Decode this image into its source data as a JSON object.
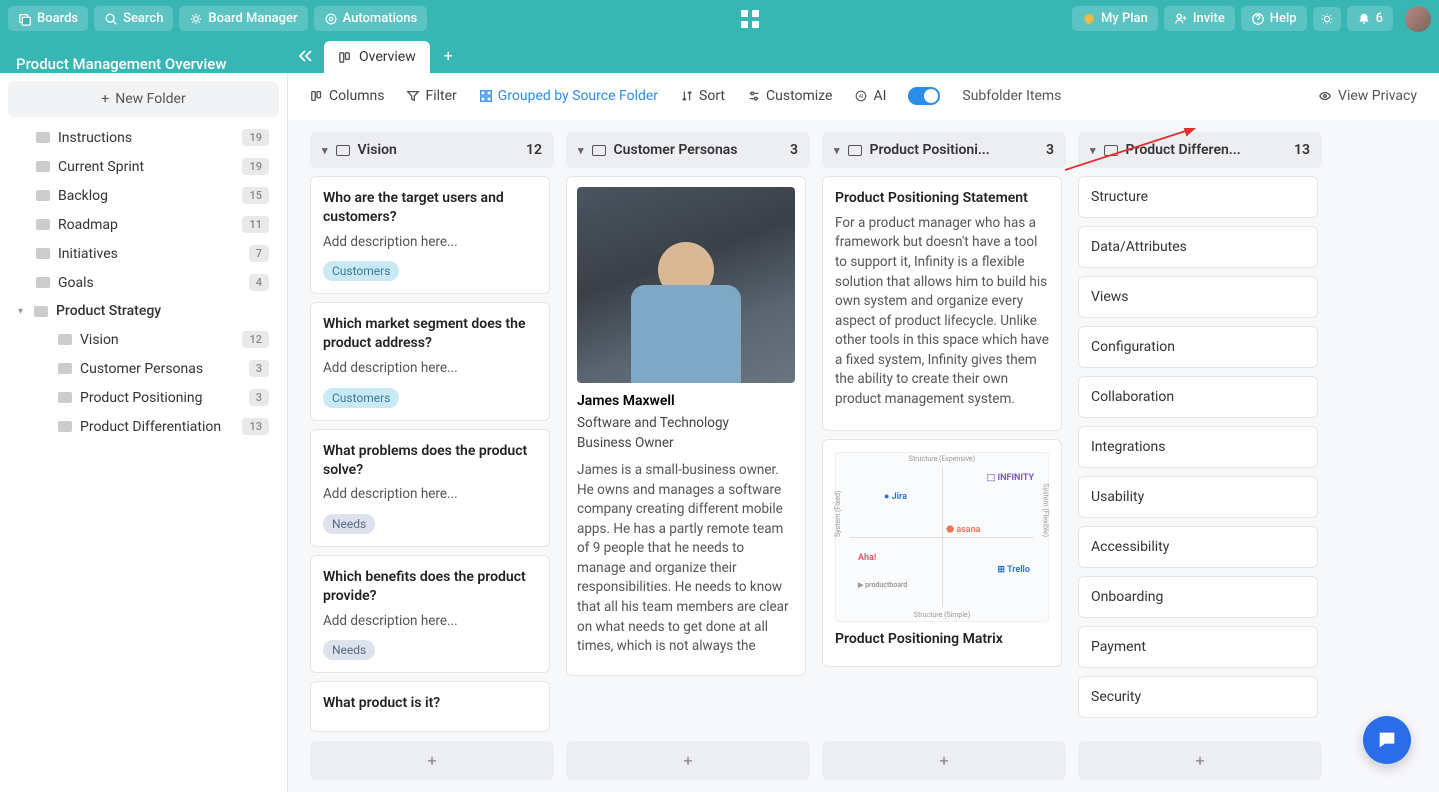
{
  "topbar": {
    "boards": "Boards",
    "search": "Search",
    "board_manager": "Board Manager",
    "automations": "Automations",
    "my_plan": "My Plan",
    "invite": "Invite",
    "help": "Help",
    "notif_count": "6"
  },
  "board_title": "Product Management Overview",
  "tabs": {
    "overview": "Overview"
  },
  "sidebar": {
    "new_folder": "New Folder",
    "items": [
      {
        "label": "Instructions",
        "count": "19"
      },
      {
        "label": "Current Sprint",
        "count": "19"
      },
      {
        "label": "Backlog",
        "count": "15"
      },
      {
        "label": "Roadmap",
        "count": "11"
      },
      {
        "label": "Initiatives",
        "count": "7"
      },
      {
        "label": "Goals",
        "count": "4"
      },
      {
        "label": "Product Strategy",
        "count": ""
      },
      {
        "label": "Vision",
        "count": "12"
      },
      {
        "label": "Customer Personas",
        "count": "3"
      },
      {
        "label": "Product Positioning",
        "count": "3"
      },
      {
        "label": "Product Differentiation",
        "count": "13"
      }
    ]
  },
  "toolbar": {
    "columns": "Columns",
    "filter": "Filter",
    "grouped": "Grouped by Source Folder",
    "sort": "Sort",
    "customize": "Customize",
    "ai": "AI",
    "subfolder": "Subfolder Items",
    "privacy": "View Privacy"
  },
  "columns": [
    {
      "title": "Vision",
      "count": "12",
      "cards": [
        {
          "title": "Who are the target users and customers?",
          "desc": "Add description here...",
          "tag": "Customers",
          "tagClass": ""
        },
        {
          "title": "Which market segment does the product address?",
          "desc": "Add description here...",
          "tag": "Customers",
          "tagClass": ""
        },
        {
          "title": "What problems does the product solve?",
          "desc": "Add description here...",
          "tag": "Needs",
          "tagClass": "needs"
        },
        {
          "title": "Which benefits does the product provide?",
          "desc": "Add description here...",
          "tag": "Needs",
          "tagClass": "needs"
        },
        {
          "title": "What product is it?",
          "desc": "",
          "tag": "",
          "tagClass": ""
        }
      ]
    },
    {
      "title": "Customer Personas",
      "count": "3",
      "persona": {
        "name": "James Maxwell",
        "role1": "Software and Technology",
        "role2": "Business Owner",
        "bio": "James is a small-business owner. He owns and manages a software company creating different mobile apps. He has a partly remote team of 9 people that he needs to manage and organize their responsibilities. He needs to know that all his team members are clear on what needs to get done at all times, which is not always the"
      }
    },
    {
      "title": "Product Positioni...",
      "count": "3",
      "statement_title": "Product Positioning Statement",
      "statement": "For a product manager who has a framework but doesn't have a tool to support it, Infinity is a flexible solution that allows him to build his own system and organize every aspect of product lifecycle. Unlike other tools in this space which have a fixed system, Infinity gives them the ability to create their own product management system.",
      "matrix_title": "Product Positioning Matrix"
    },
    {
      "title": "Product Differen...",
      "count": "13",
      "items": [
        "Structure",
        "Data/Attributes",
        "Views",
        "Configuration",
        "Collaboration",
        "Integrations",
        "Usability",
        "Accessibility",
        "Onboarding",
        "Payment",
        "Security"
      ]
    }
  ]
}
